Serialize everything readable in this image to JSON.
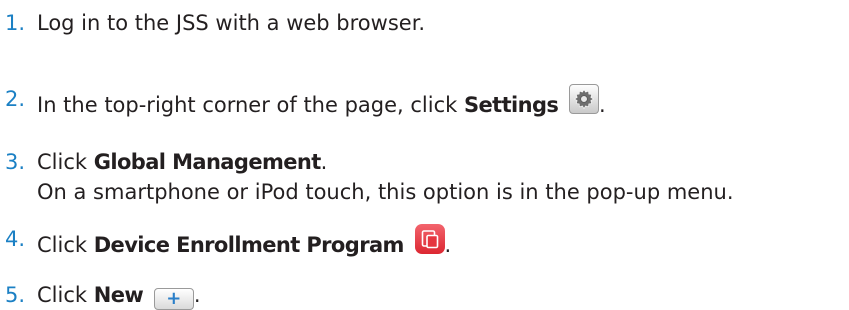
{
  "steps": [
    {
      "number": "1.",
      "text": "Log in to the JSS with a web browser."
    },
    {
      "number": "2.",
      "pre": "In the top-right corner of the page, click ",
      "bold": "Settings",
      "icon": "gear-icon",
      "post": "."
    },
    {
      "number": "3.",
      "pre": "Click ",
      "bold": "Global Management",
      "post": ".",
      "note": "On a smartphone or iPod touch, this option is in the pop-up menu."
    },
    {
      "number": "4.",
      "pre": "Click ",
      "bold": "Device Enrollment Program",
      "icon": "device-enrollment-icon",
      "post": "."
    },
    {
      "number": "5.",
      "pre": "Click ",
      "bold": "New",
      "icon": "plus-icon",
      "icon_text": "+",
      "post": "."
    }
  ],
  "colors": {
    "number": "#1b80c4",
    "text": "#231f20",
    "dep_icon": "#e5363f",
    "plus": "#2a7fc9"
  }
}
